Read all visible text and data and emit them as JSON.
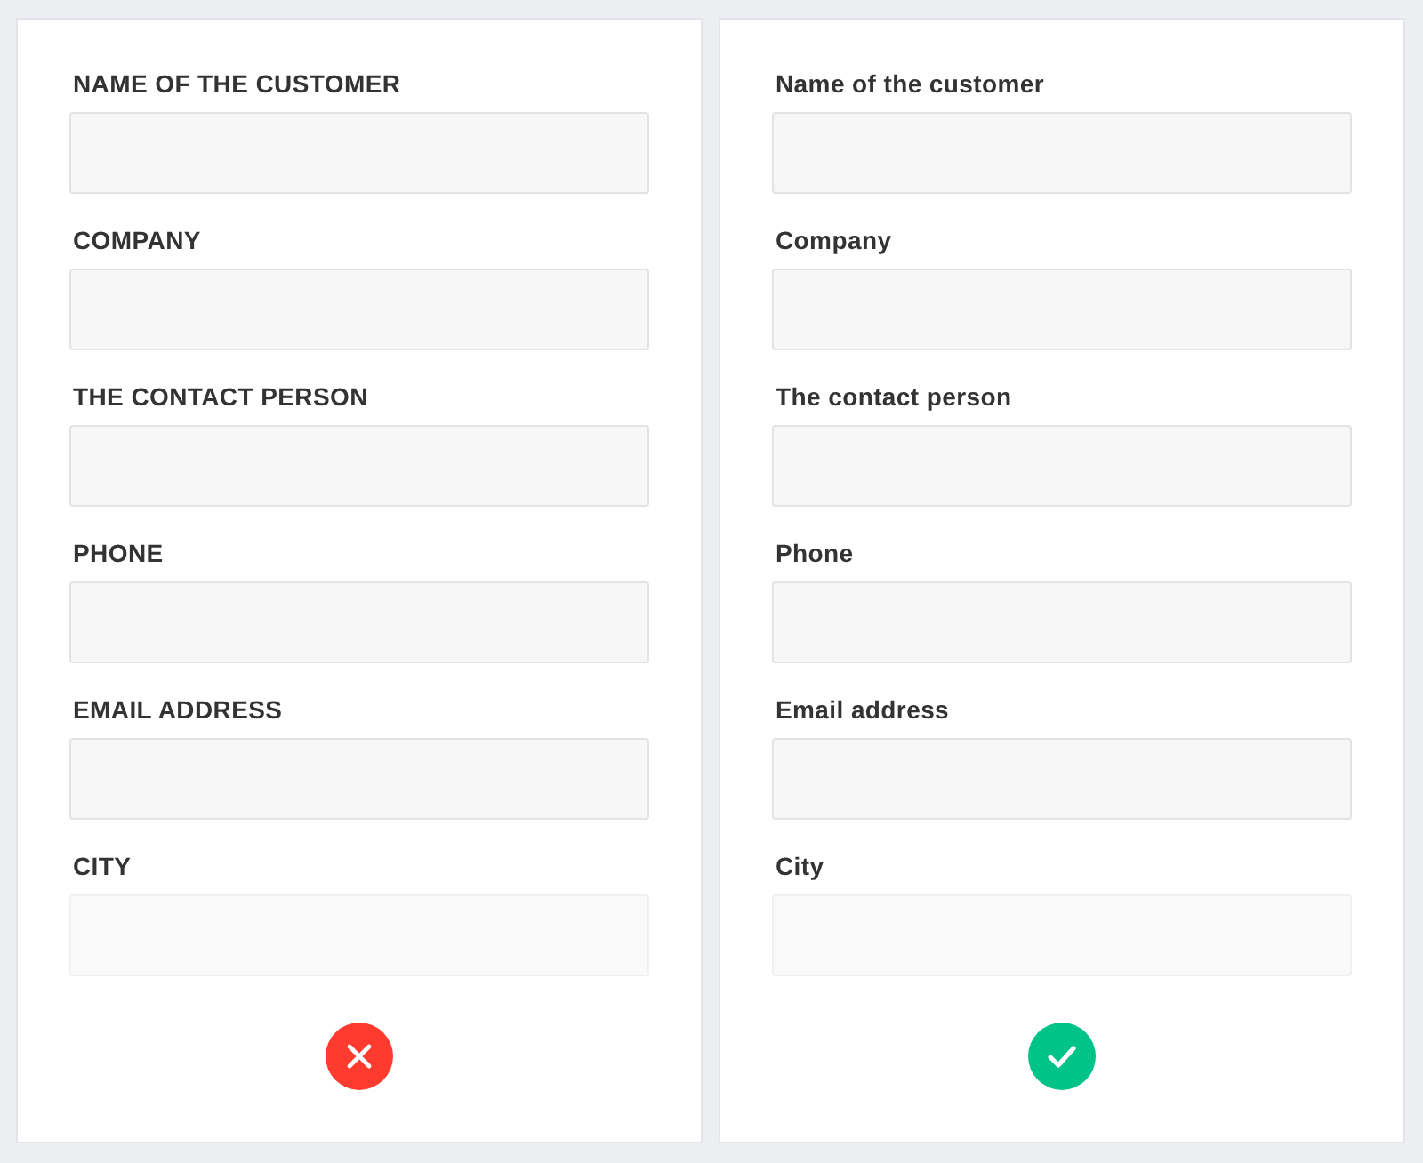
{
  "panels": [
    {
      "kind": "wrong",
      "color": "#ff3b30",
      "fields": [
        {
          "label": "NAME OF THE CUSTOMER"
        },
        {
          "label": "COMPANY"
        },
        {
          "label": "THE CONTACT PERSON"
        },
        {
          "label": "PHONE"
        },
        {
          "label": "EMAIL ADDRESS"
        },
        {
          "label": "CITY"
        }
      ]
    },
    {
      "kind": "right",
      "color": "#00c389",
      "fields": [
        {
          "label": "Name of the customer"
        },
        {
          "label": "Company"
        },
        {
          "label": "The contact person"
        },
        {
          "label": "Phone"
        },
        {
          "label": "Email address"
        },
        {
          "label": "City"
        }
      ]
    }
  ]
}
